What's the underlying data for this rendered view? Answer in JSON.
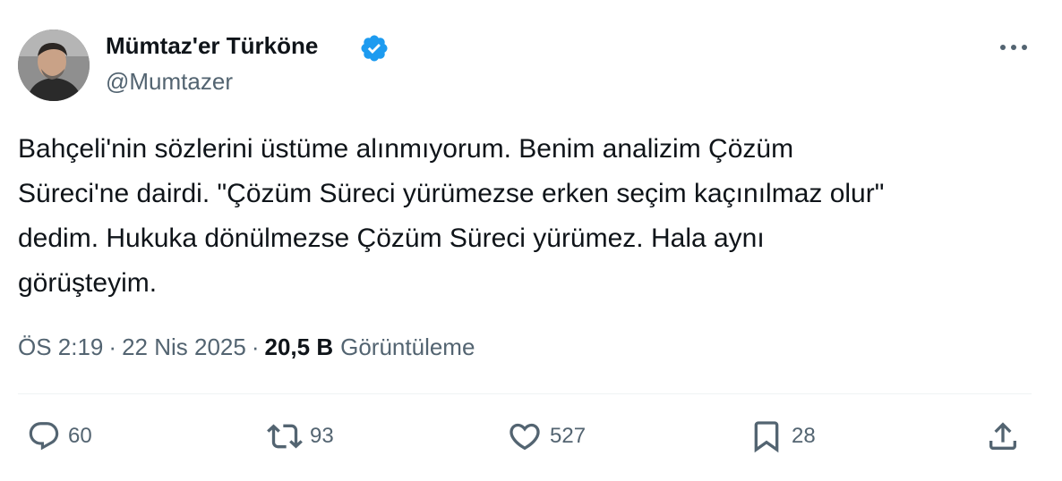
{
  "author": {
    "name": "Mümtaz'er Türköne",
    "handle": "@Mumtazer",
    "verified_color": "#1d9bf0"
  },
  "icons": {
    "verified": "verified-badge-icon",
    "more": "more-dots-icon",
    "reply": "reply-bubble-icon",
    "retweet": "retweet-icon",
    "like": "heart-icon",
    "bookmark": "bookmark-icon",
    "share": "share-upload-icon"
  },
  "tweet": {
    "lines": [
      "Bahçeli'nin sözlerini üstüme alınmıyorum. Benim analizim Çözüm",
      "Süreci'ne dairdi. \"Çözüm Süreci yürümezse erken seçim kaçınılmaz olur\"",
      "dedim. Hukuka dönülmezse Çözüm Süreci yürümez. Hala aynı",
      "görüşteyim."
    ]
  },
  "meta": {
    "time": "ÖS 2:19",
    "separator": "·",
    "date": "22 Nis 2025",
    "views_count": "20,5 B",
    "views_label": "Görüntüleme"
  },
  "actions": {
    "replies": "60",
    "retweets": "93",
    "likes": "527",
    "bookmarks": "28"
  },
  "colors": {
    "text": "#0f1419",
    "secondary": "#536471",
    "divider": "#eff3f4",
    "accent": "#1d9bf0"
  }
}
